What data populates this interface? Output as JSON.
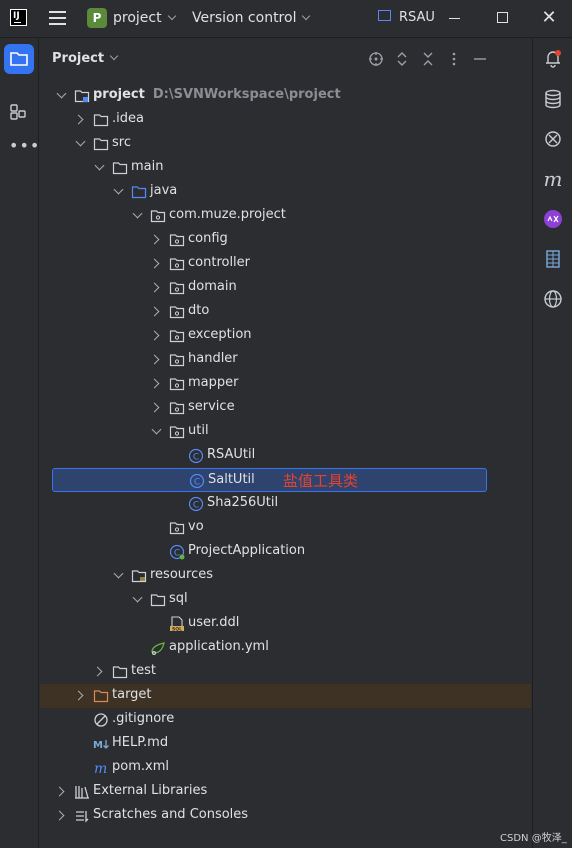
{
  "titlebar": {
    "project_badge": "P",
    "project_name": "project",
    "vcs_label": "Version control",
    "open_tab": "RSAU",
    "close_glyph": "✕"
  },
  "panel": {
    "title": "Project"
  },
  "tree": [
    {
      "depth": 0,
      "label": "project",
      "path": "D:\\SVNWorkspace\\project",
      "arrow": "down",
      "icon": "module",
      "bold": true
    },
    {
      "depth": 1,
      "label": ".idea",
      "arrow": "right",
      "icon": "folder"
    },
    {
      "depth": 1,
      "label": "src",
      "arrow": "down",
      "icon": "folder"
    },
    {
      "depth": 2,
      "label": "main",
      "arrow": "down",
      "icon": "folder"
    },
    {
      "depth": 3,
      "label": "java",
      "arrow": "down",
      "icon": "folder-source"
    },
    {
      "depth": 4,
      "label": "com.muze.project",
      "arrow": "down",
      "icon": "package"
    },
    {
      "depth": 5,
      "label": "config",
      "arrow": "right",
      "icon": "package"
    },
    {
      "depth": 5,
      "label": "controller",
      "arrow": "right",
      "icon": "package"
    },
    {
      "depth": 5,
      "label": "domain",
      "arrow": "right",
      "icon": "package"
    },
    {
      "depth": 5,
      "label": "dto",
      "arrow": "right",
      "icon": "package"
    },
    {
      "depth": 5,
      "label": "exception",
      "arrow": "right",
      "icon": "package"
    },
    {
      "depth": 5,
      "label": "handler",
      "arrow": "right",
      "icon": "package"
    },
    {
      "depth": 5,
      "label": "mapper",
      "arrow": "right",
      "icon": "package"
    },
    {
      "depth": 5,
      "label": "service",
      "arrow": "right",
      "icon": "package"
    },
    {
      "depth": 5,
      "label": "util",
      "arrow": "down",
      "icon": "package"
    },
    {
      "depth": 6,
      "label": "RSAUtil",
      "icon": "class"
    },
    {
      "depth": 6,
      "label": "SaltUtil",
      "icon": "class",
      "selected": true
    },
    {
      "depth": 6,
      "label": "Sha256Util",
      "icon": "class"
    },
    {
      "depth": 5,
      "label": "vo",
      "icon": "package"
    },
    {
      "depth": 5,
      "label": "ProjectApplication",
      "icon": "spring-class"
    },
    {
      "depth": 3,
      "label": "resources",
      "arrow": "down",
      "icon": "folder-resources"
    },
    {
      "depth": 4,
      "label": "sql",
      "arrow": "down",
      "icon": "folder"
    },
    {
      "depth": 5,
      "label": "user.ddl",
      "icon": "sql-file"
    },
    {
      "depth": 4,
      "label": "application.yml",
      "icon": "yml-file"
    },
    {
      "depth": 2,
      "label": "test",
      "arrow": "right",
      "icon": "folder"
    },
    {
      "depth": 1,
      "label": "target",
      "arrow": "right",
      "icon": "folder-excluded",
      "excluded": true
    },
    {
      "depth": 1,
      "label": ".gitignore",
      "icon": "ignore-file"
    },
    {
      "depth": 1,
      "label": "HELP.md",
      "icon": "markdown-file"
    },
    {
      "depth": 1,
      "label": "pom.xml",
      "icon": "maven-file"
    },
    {
      "depth": 0,
      "label": "External Libraries",
      "arrow": "right",
      "icon": "libraries"
    },
    {
      "depth": 0,
      "label": "Scratches and Consoles",
      "arrow": "right",
      "icon": "scratches"
    }
  ],
  "annotation": "盐值工具类",
  "watermark": "CSDN @牧泽_",
  "icons": {
    "left": [
      "project-folder-icon",
      "structure-icon",
      "more-icon"
    ],
    "right": [
      "notifications-icon",
      "database-icon",
      "ai-assistant-icon",
      "maven-icon",
      "ai-icon",
      "sequence-icon",
      "web-icon"
    ]
  },
  "colors": {
    "accent": "#3574f0",
    "selection": "#2e436e",
    "annotation": "#e5432f",
    "excluded": "#3d3223"
  }
}
